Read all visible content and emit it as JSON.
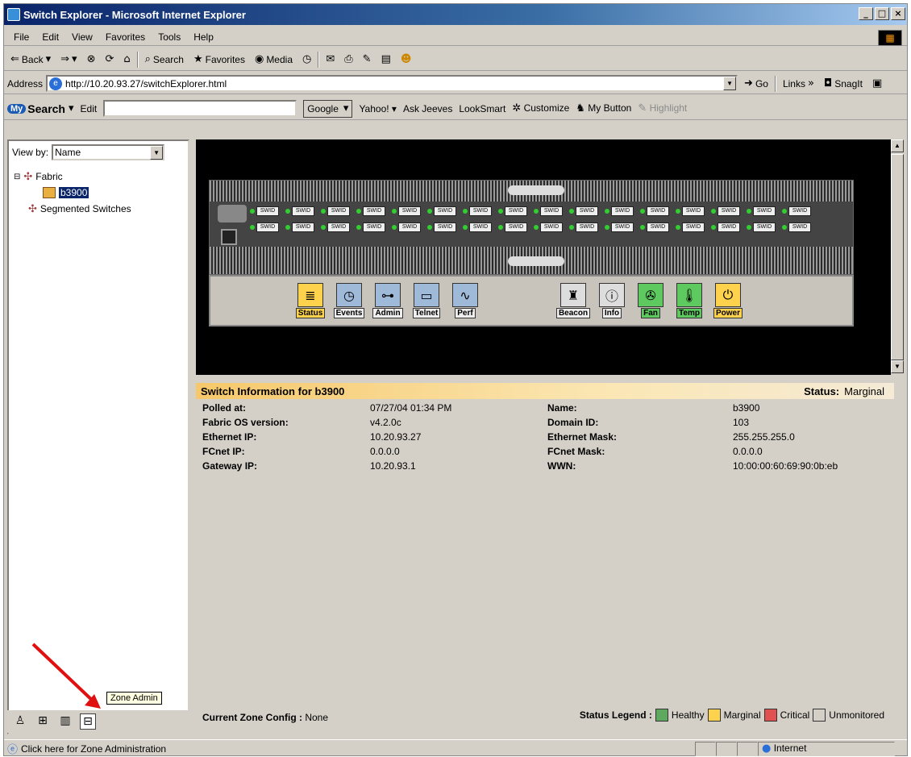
{
  "window": {
    "title": "Switch Explorer - Microsoft Internet Explorer"
  },
  "menu": [
    "File",
    "Edit",
    "View",
    "Favorites",
    "Tools",
    "Help"
  ],
  "toolbar": {
    "back": "Back",
    "search": "Search",
    "favorites": "Favorites",
    "media": "Media"
  },
  "address": {
    "label": "Address",
    "url": "http://10.20.93.27/switchExplorer.html",
    "go": "Go",
    "links": "Links",
    "snagit": "SnagIt"
  },
  "searchbar": {
    "brand": "Search",
    "edit": "Edit",
    "google": "Google",
    "items": [
      "Yahoo!",
      "Ask Jeeves",
      "LookSmart",
      "Customize",
      "My Button",
      "Highlight"
    ]
  },
  "left": {
    "viewby_label": "View by:",
    "viewby_value": "Name",
    "tree": {
      "fabric": "Fabric",
      "switch": "b3900",
      "segmented": "Segmented Switches"
    },
    "tooltip": "Zone Admin"
  },
  "switch_icons": [
    "Status",
    "Events",
    "Admin",
    "Telnet",
    "Perf",
    "Beacon",
    "Info",
    "Fan",
    "Temp",
    "Power"
  ],
  "port_label": "SWID",
  "info": {
    "header": "Switch Information for b3900",
    "status_label": "Status:",
    "status_value": "Marginal",
    "fields": {
      "polled_label": "Polled at:",
      "polled_value": "07/27/04 01:34 PM",
      "fabricos_label": "Fabric OS version:",
      "fabricos_value": "v4.2.0c",
      "ethip_label": "Ethernet IP:",
      "ethip_value": "10.20.93.27",
      "fcnetip_label": "FCnet IP:",
      "fcnetip_value": "0.0.0.0",
      "gateway_label": "Gateway IP:",
      "gateway_value": "10.20.93.1",
      "name_label": "Name:",
      "name_value": "b3900",
      "domain_label": "Domain ID:",
      "domain_value": "103",
      "ethmask_label": "Ethernet Mask:",
      "ethmask_value": "255.255.255.0",
      "fcnetmask_label": "FCnet Mask:",
      "fcnetmask_value": "0.0.0.0",
      "wwn_label": "WWN:",
      "wwn_value": "10:00:00:60:69:90:0b:eb"
    },
    "zone_label": "Current Zone Config :",
    "zone_value": "None",
    "legend_label": "Status Legend :",
    "legend": [
      {
        "name": "Healthy",
        "color": "#5fa85f"
      },
      {
        "name": "Marginal",
        "color": "#ffd24d"
      },
      {
        "name": "Critical",
        "color": "#e05050"
      },
      {
        "name": "Unmonitored",
        "color": "#d4d0c8"
      }
    ]
  },
  "statusbar": {
    "text": "Click here for Zone Administration",
    "zone": "Internet"
  }
}
